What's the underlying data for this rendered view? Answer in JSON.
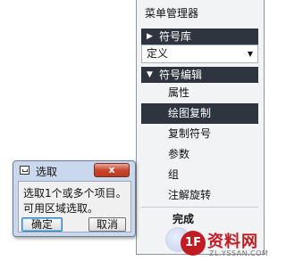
{
  "menu_manager": {
    "title": "菜单管理器",
    "symbol_library": {
      "label": "符号库",
      "collapsed": true
    },
    "dropdown_value": "定义",
    "symbol_edit": {
      "label": "符号编辑",
      "expanded": true
    },
    "items": [
      {
        "label": "属性",
        "selected": false
      },
      {
        "label": "绘图复制",
        "selected": true
      },
      {
        "label": "复制符号",
        "selected": false
      },
      {
        "label": "参数",
        "selected": false
      },
      {
        "label": "组",
        "selected": false
      },
      {
        "label": "注解旋转",
        "selected": false
      }
    ],
    "done_label": "完成"
  },
  "dialog": {
    "title": "选取",
    "close_label": "x",
    "message_line1": "选取1个或多个项目。",
    "message_line2": "可用区域选取。",
    "ok_label": "确定",
    "cancel_label": "取消"
  },
  "watermark": {
    "logo_text": "1F",
    "text": "资料网",
    "url": "ZL.YSSAN.COM"
  },
  "colors": {
    "header_dark": "#2f353e",
    "dialog_frame": "#c9d8ec",
    "close_red": "#c9472f",
    "watermark_red": "#c11c24"
  }
}
